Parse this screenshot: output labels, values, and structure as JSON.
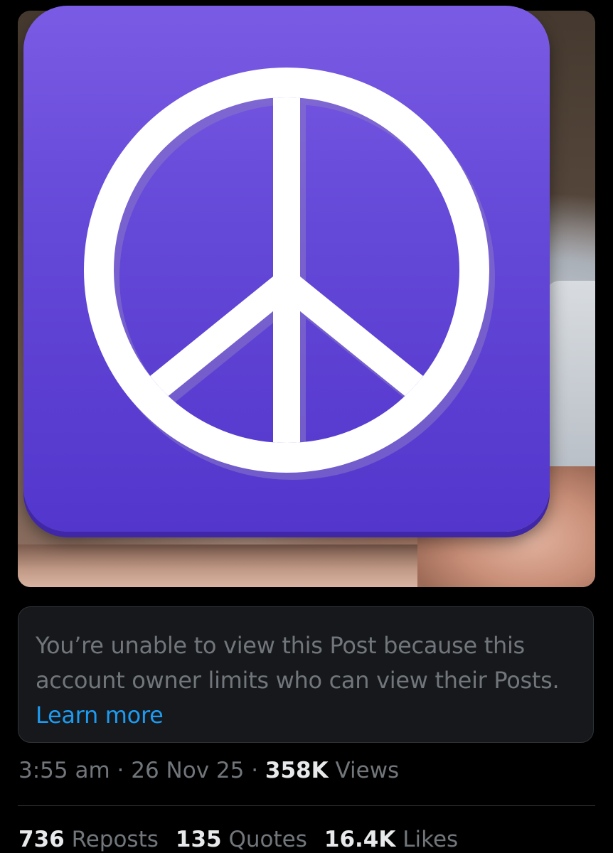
{
  "post": {
    "media_alt_icon": "peace-sign-icon",
    "colors": {
      "app_icon": "#6549d8",
      "link": "#1d9bf0",
      "muted_text": "#71767b",
      "bright_text": "#e7e9ea"
    }
  },
  "notice": {
    "text": "You’re unable to view this Post because this account owner limits who can view their Posts. ",
    "link_label": "Learn more"
  },
  "meta": {
    "time": "3:55 am",
    "separator1": " · ",
    "date": "26 Nov 25",
    "separator2": " · ",
    "views_count": "358K",
    "views_label": " Views"
  },
  "stats": {
    "reposts_count": "736",
    "reposts_label": " Reposts",
    "quotes_count": "135",
    "quotes_label": " Quotes",
    "likes_count": "16.4K",
    "likes_label": " Likes"
  }
}
